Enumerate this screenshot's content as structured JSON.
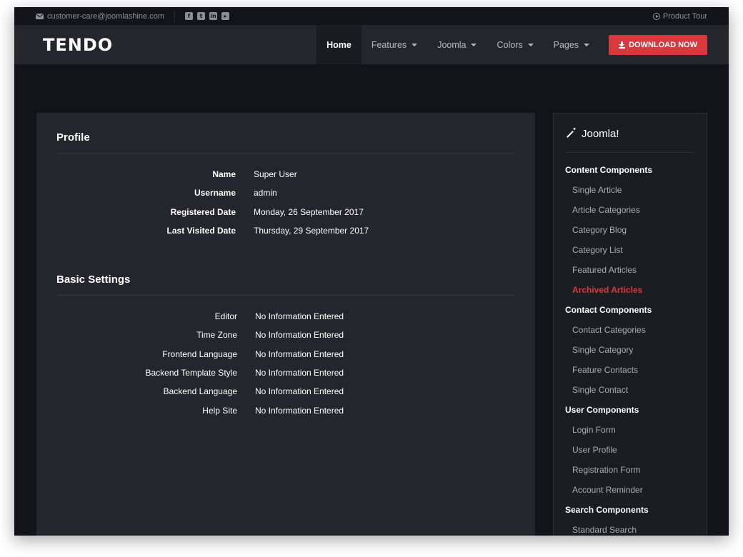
{
  "topbar": {
    "email": "customer-care@joomlashine.com",
    "social_icons": [
      "facebook-icon",
      "twitter-icon",
      "linkedin-icon",
      "youtube-icon"
    ],
    "product_tour": "Product Tour"
  },
  "navbar": {
    "logo": "TENDO",
    "items": [
      {
        "label": "Home",
        "active": true
      },
      {
        "label": "Features",
        "dropdown": true
      },
      {
        "label": "Joomla",
        "dropdown": true
      },
      {
        "label": "Colors",
        "dropdown": true
      },
      {
        "label": "Pages",
        "dropdown": true
      }
    ],
    "download_label": "DOWNLOAD NOW"
  },
  "profile": {
    "title": "Profile",
    "fields": [
      {
        "label": "Name",
        "value": "Super User"
      },
      {
        "label": "Username",
        "value": "admin"
      },
      {
        "label": "Registered Date",
        "value": "Monday, 26 September 2017"
      },
      {
        "label": "Last Visited Date",
        "value": "Thursday, 29 September 2017"
      }
    ]
  },
  "settings": {
    "title": "Basic Settings",
    "fields": [
      {
        "label": "Editor",
        "value": "No Information Entered"
      },
      {
        "label": "Time Zone",
        "value": "No Information Entered"
      },
      {
        "label": "Frontend Language",
        "value": "No Information Entered"
      },
      {
        "label": "Backend Template Style",
        "value": "No Information Entered"
      },
      {
        "label": "Backend Language",
        "value": "No Information Entered"
      },
      {
        "label": "Help Site",
        "value": "No Information Entered"
      }
    ]
  },
  "sidebar": {
    "title": "Joomla!",
    "groups": [
      {
        "label": "Content Components",
        "links": [
          "Single Article",
          "Article Categories",
          "Category Blog",
          "Category List",
          "Featured Articles",
          "Archived Articles"
        ]
      },
      {
        "label": "Contact Components",
        "links": [
          "Contact Categories",
          "Single Category",
          "Feature Contacts",
          "Single Contact"
        ]
      },
      {
        "label": "User Components",
        "links": [
          "Login Form",
          "User Profile",
          "Registration Form",
          "Account Reminder"
        ]
      },
      {
        "label": "Search Components",
        "links": [
          "Standard Search"
        ]
      }
    ],
    "active_link": "Archived Articles"
  },
  "colors": {
    "accent": "#d63a3e",
    "background": "#131417",
    "panel": "#25262b"
  }
}
